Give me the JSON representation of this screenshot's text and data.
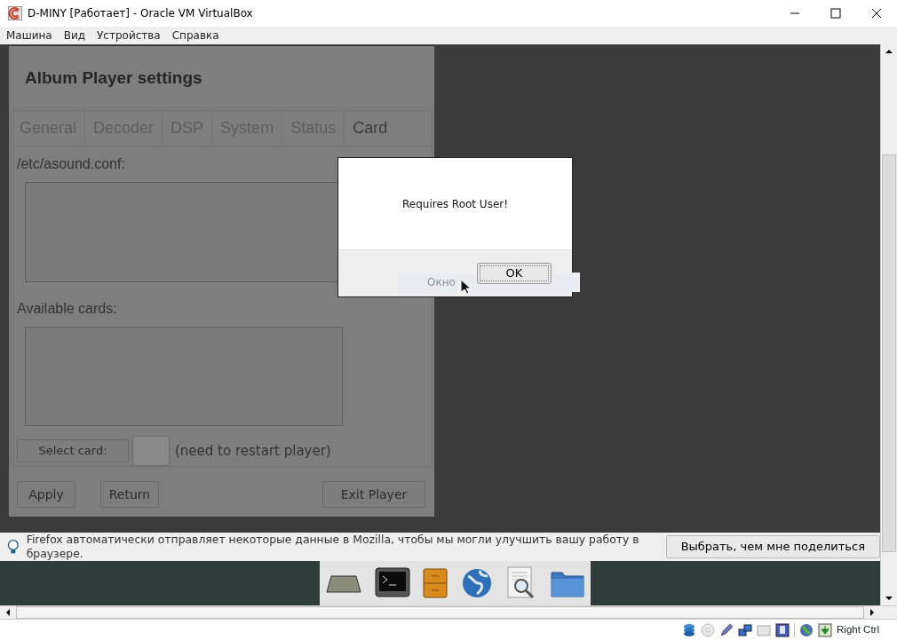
{
  "window": {
    "title": "D-MINY [Работает] - Oracle VM VirtualBox"
  },
  "menu": [
    "Машина",
    "Вид",
    "Устройства",
    "Справка"
  ],
  "app_window": {
    "title": "Album Player settings",
    "tabs": [
      {
        "label": "General",
        "selected": false
      },
      {
        "label": "Decoder",
        "selected": false
      },
      {
        "label": "DSP",
        "selected": false
      },
      {
        "label": "System",
        "selected": false
      },
      {
        "label": "Status",
        "selected": false
      },
      {
        "label": "Card",
        "selected": true
      }
    ],
    "conf_label": "/etc/asound.conf:",
    "cards_label": "Available cards:",
    "select_button": "Select card:",
    "restart_note": "(need to restart player)",
    "buttons": [
      "Apply",
      "Return",
      "Exit Player"
    ]
  },
  "dialog": {
    "message": "Requires Root User!",
    "button": "OK",
    "hint": "Окно"
  },
  "notification": {
    "message": "Firefox автоматически отправляет некоторые данные в Mozilla, чтобы мы могли улучшить вашу работу в браузере.",
    "button": "Выбрать, чем мне поделиться"
  },
  "status_bar": {
    "host_key": "Right Ctrl"
  }
}
